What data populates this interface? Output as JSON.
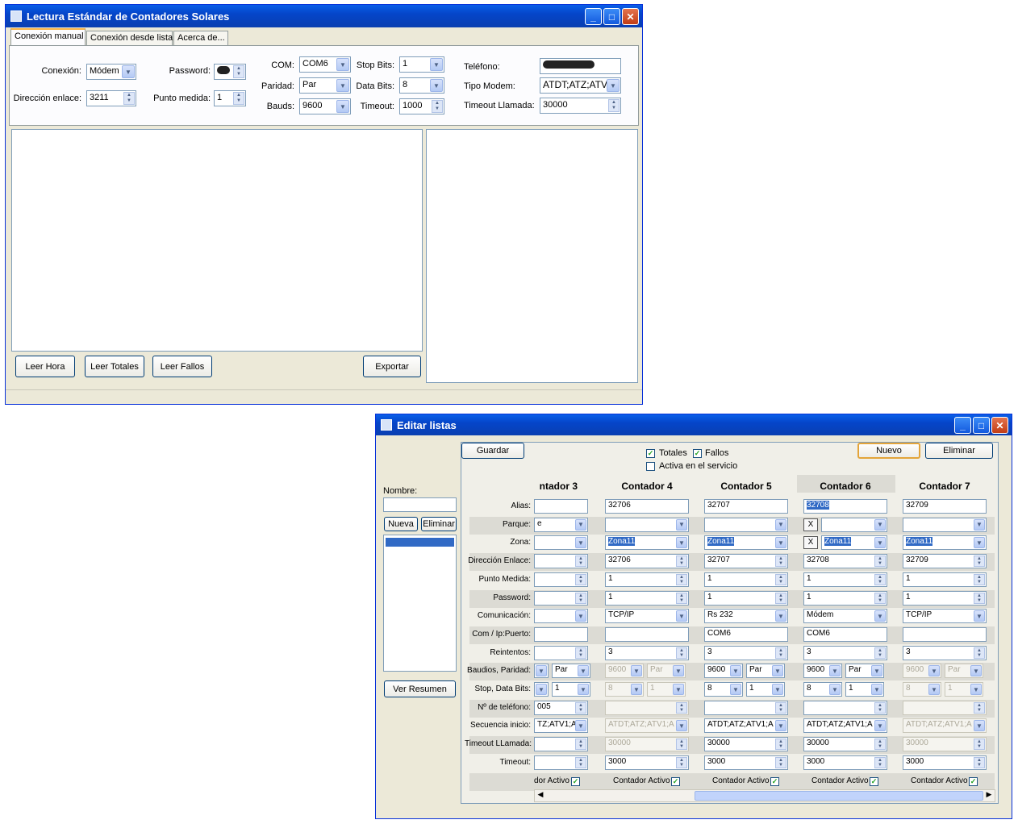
{
  "main": {
    "title": "Lectura Estándar de Contadores Solares",
    "tabs": [
      "Conexión manual",
      "Conexión desde lista",
      "Acerca de..."
    ],
    "labels": {
      "conexion": "Conexión:",
      "direccion": "Dirección enlace:",
      "password": "Password:",
      "punto": "Punto medida:",
      "com": "COM:",
      "paridad": "Paridad:",
      "bauds": "Bauds:",
      "stop": "Stop Bits:",
      "data": "Data Bits:",
      "timeout": "Timeout:",
      "telefono": "Teléfono:",
      "tipo": "Tipo Modem:",
      "timeout_llamada": "Timeout Llamada:"
    },
    "values": {
      "conexion": "Módem",
      "direccion": "3211",
      "punto": "1",
      "com": "COM6",
      "paridad": "Par",
      "bauds": "9600",
      "stop": "1",
      "data": "8",
      "timeout": "1000",
      "tipo": "ATDT;ATZ;ATV",
      "timeout_llamada": "30000"
    },
    "buttons": {
      "hora": "Leer Hora",
      "totales": "Leer Totales",
      "fallos": "Leer Fallos",
      "exportar": "Exportar"
    }
  },
  "editor": {
    "title": "Editar listas",
    "guardar": "Guardar",
    "nuevo": "Nuevo",
    "eliminar": "Eliminar",
    "chk_totales": "Totales",
    "chk_fallos": "Fallos",
    "chk_activa": "Activa en el servicio",
    "nombre": "Nombre:",
    "nueva": "Nueva",
    "eliminar_lista": "Eliminar",
    "ver_resumen": "Ver Resumen",
    "row_labels": [
      "Alias:",
      "Parque:",
      "Zona:",
      "Dirección Enlace:",
      "Punto Medida:",
      "Password:",
      "Comunicación:",
      "Com / Ip:Puerto:",
      "Reintentos:",
      "Baudios, Paridad:",
      "Stop, Data Bits:",
      "Nº de teléfono:",
      "Secuencia inicio:",
      "Timeout LLamada:",
      "Timeout:"
    ],
    "activo_label": "Contador Activo",
    "columns": [
      {
        "head": "ntador 3",
        "alias": "",
        "parque": "e",
        "zona": "",
        "dir": "",
        "punto": "",
        "pass": "",
        "com": "",
        "ip": "",
        "reint": "",
        "baud": "",
        "par": "Par",
        "stop": "",
        "data": "1",
        "tel": "005",
        "seq": "TZ;ATV1;A",
        "tllam": "",
        "tout": "",
        "activo": "dor Activo"
      },
      {
        "head": "Contador 4",
        "alias": "32706",
        "parque": "",
        "zona": "Zona11",
        "dir": "32706",
        "punto": "1",
        "pass": "1",
        "com": "TCP/IP",
        "ip": "",
        "reint": "3",
        "baud": "9600",
        "par": "Par",
        "stop": "8",
        "data": "1",
        "tel": "",
        "seq": "ATDT;ATZ;ATV1;A",
        "tllam": "30000",
        "tout": "3000",
        "activo": "Contador Activo"
      },
      {
        "head": "Contador 5",
        "alias": "32707",
        "parque": "",
        "zona": "Zona11",
        "dir": "32707",
        "punto": "1",
        "pass": "1",
        "com": "Rs 232",
        "ip": "COM6",
        "reint": "3",
        "baud": "9600",
        "par": "Par",
        "stop": "8",
        "data": "1",
        "tel": "",
        "seq": "ATDT;ATZ;ATV1;A",
        "tllam": "30000",
        "tout": "3000",
        "activo": "Contador Activo"
      },
      {
        "head": "Contador 6",
        "alias": "32708",
        "parque": "",
        "zona": "Zona11",
        "dir": "32708",
        "punto": "1",
        "pass": "1",
        "com": "Módem",
        "ip": "COM6",
        "reint": "3",
        "baud": "9600",
        "par": "Par",
        "stop": "8",
        "data": "1",
        "tel": "",
        "seq": "ATDT;ATZ;ATV1;A",
        "tllam": "30000",
        "tout": "3000",
        "activo": "Contador Activo",
        "x": "X"
      },
      {
        "head": "Contador 7",
        "alias": "32709",
        "parque": "",
        "zona": "Zona11",
        "dir": "32709",
        "punto": "1",
        "pass": "1",
        "com": "TCP/IP",
        "ip": "",
        "reint": "3",
        "baud": "9600",
        "par": "Par",
        "stop": "8",
        "data": "1",
        "tel": "",
        "seq": "ATDT;ATZ;ATV1;A",
        "tllam": "30000",
        "tout": "3000",
        "activo": "Contador Activo"
      }
    ]
  }
}
